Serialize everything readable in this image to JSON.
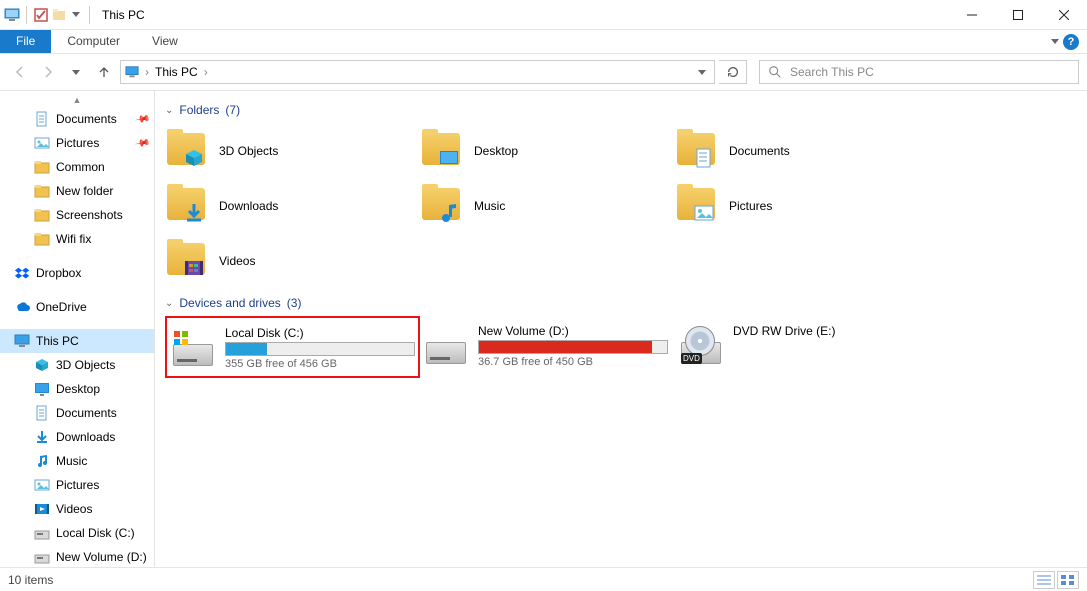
{
  "window": {
    "title": "This PC"
  },
  "tabs": {
    "file": "File",
    "computer": "Computer",
    "view": "View"
  },
  "address": {
    "location": "This PC"
  },
  "search": {
    "placeholder": "Search This PC"
  },
  "sidebar": {
    "items": [
      {
        "label": "Documents",
        "icon": "doc",
        "depth": 1,
        "pinned": true
      },
      {
        "label": "Pictures",
        "icon": "pic",
        "depth": 1,
        "pinned": true
      },
      {
        "label": "Common",
        "icon": "folder",
        "depth": 1
      },
      {
        "label": "New folder",
        "icon": "folder",
        "depth": 1
      },
      {
        "label": "Screenshots",
        "icon": "folder",
        "depth": 1
      },
      {
        "label": "Wifi fix",
        "icon": "folder",
        "depth": 1
      },
      {
        "label": "Dropbox",
        "icon": "dropbox",
        "depth": 0,
        "spaceBefore": true
      },
      {
        "label": "OneDrive",
        "icon": "onedrive",
        "depth": 0,
        "spaceBefore": true
      },
      {
        "label": "This PC",
        "icon": "thispc",
        "depth": 0,
        "spaceBefore": true,
        "selected": true
      },
      {
        "label": "3D Objects",
        "icon": "3d",
        "depth": 1
      },
      {
        "label": "Desktop",
        "icon": "desktop",
        "depth": 1
      },
      {
        "label": "Documents",
        "icon": "doc",
        "depth": 1
      },
      {
        "label": "Downloads",
        "icon": "download",
        "depth": 1
      },
      {
        "label": "Music",
        "icon": "music",
        "depth": 1
      },
      {
        "label": "Pictures",
        "icon": "pic",
        "depth": 1
      },
      {
        "label": "Videos",
        "icon": "video",
        "depth": 1
      },
      {
        "label": "Local Disk (C:)",
        "icon": "disk",
        "depth": 1
      },
      {
        "label": "New Volume (D:)",
        "icon": "disk",
        "depth": 1
      }
    ]
  },
  "groups": {
    "folders": {
      "title": "Folders",
      "count": "(7)",
      "items": [
        {
          "label": "3D Objects",
          "overlay": "3d"
        },
        {
          "label": "Desktop",
          "overlay": "desktop"
        },
        {
          "label": "Documents",
          "overlay": "doc"
        },
        {
          "label": "Downloads",
          "overlay": "download"
        },
        {
          "label": "Music",
          "overlay": "music"
        },
        {
          "label": "Pictures",
          "overlay": "pic"
        },
        {
          "label": "Videos",
          "overlay": "video"
        }
      ]
    },
    "drives": {
      "title": "Devices and drives",
      "count": "(3)",
      "items": [
        {
          "label": "Local Disk (C:)",
          "free": "355 GB free of 456 GB",
          "fillPct": 22,
          "color": "#26a0da",
          "os": true,
          "highlight": true
        },
        {
          "label": "New Volume (D:)",
          "free": "36.7 GB free of 450 GB",
          "fillPct": 92,
          "color": "#d92a1c"
        },
        {
          "label": "DVD RW Drive (E:)",
          "type": "dvd"
        }
      ]
    }
  },
  "status": {
    "text": "10 items"
  }
}
